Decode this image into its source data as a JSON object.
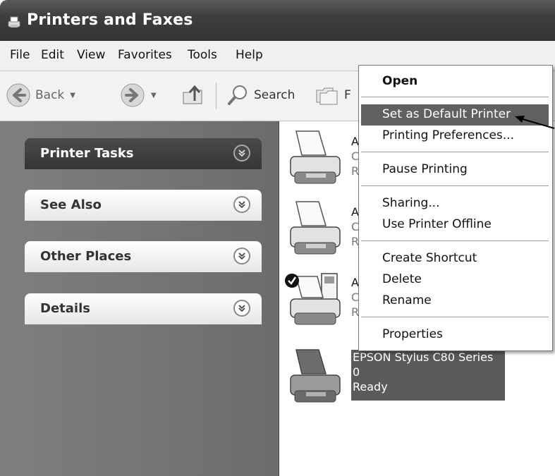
{
  "window": {
    "title": "Printers and Faxes",
    "title_icon": "printers-folder-icon"
  },
  "menubar": {
    "items": [
      "File",
      "Edit",
      "View",
      "Favorites",
      "Tools",
      "Help"
    ]
  },
  "toolbar": {
    "back_label": "Back",
    "search_label": "Search",
    "folders_label_visible": "F"
  },
  "task_pane": {
    "panels": [
      {
        "title": "Printer Tasks",
        "state": "active"
      },
      {
        "title": "See Also"
      },
      {
        "title": "Other Places"
      },
      {
        "title": "Details"
      }
    ]
  },
  "printers": {
    "items": [
      {
        "name": "A",
        "line2": "C",
        "line3": "R",
        "icon": "printer-icon"
      },
      {
        "name": "A",
        "line2": "C",
        "line3": "R",
        "icon": "printer-icon"
      },
      {
        "name": "A",
        "line2": "C",
        "line3": "R",
        "icon": "default-printer-fax-icon",
        "default": true
      },
      {
        "name": "EPSON Stylus C80 Series",
        "line2": "0",
        "line3": "Ready",
        "icon": "printer-icon",
        "selected": true
      }
    ]
  },
  "context_menu": {
    "items": [
      {
        "label": "Open",
        "bold": true
      },
      {
        "label": "Set as Default Printer",
        "highlighted": true
      },
      {
        "label": "Printing Preferences..."
      },
      {
        "label": "Pause Printing"
      },
      {
        "label": "Sharing..."
      },
      {
        "label": "Use Printer Offline"
      },
      {
        "label": "Create Shortcut"
      },
      {
        "label": "Delete"
      },
      {
        "label": "Rename"
      },
      {
        "label": "Properties"
      }
    ]
  },
  "colors": {
    "titlebar": "#3e3e3e",
    "task_pane": "#757575",
    "highlight": "#606060"
  }
}
